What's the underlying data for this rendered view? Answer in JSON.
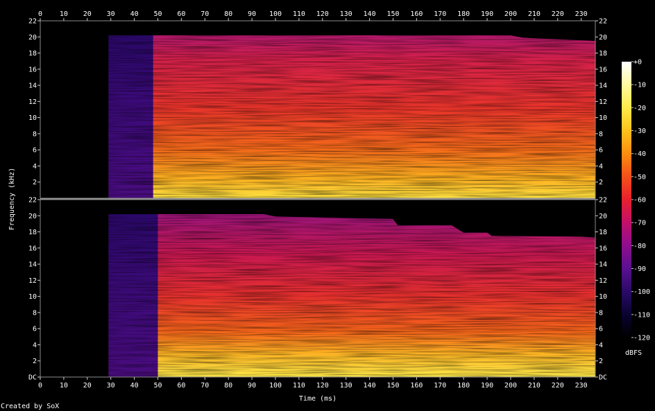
{
  "chart_data": {
    "type": "heatmap",
    "subtype": "spectrogram",
    "xlabel": "Time (ms)",
    "ylabel": "Frequency (kHz)",
    "xlim": [
      0,
      236
    ],
    "ylim": [
      0,
      22
    ],
    "x_ticks": [
      0,
      10,
      20,
      30,
      40,
      50,
      60,
      70,
      80,
      90,
      100,
      110,
      120,
      130,
      140,
      150,
      160,
      170,
      180,
      190,
      200,
      210,
      220,
      230
    ],
    "y_ticks": [
      0,
      2,
      4,
      6,
      8,
      10,
      12,
      14,
      16,
      18,
      20,
      22
    ],
    "y_tick_labels_top": [
      "2",
      "4",
      "6",
      "8",
      "10",
      "12",
      "14",
      "16",
      "18",
      "20",
      "22"
    ],
    "y_tick_labels_bottom": [
      "DC",
      "2",
      "4",
      "6",
      "8",
      "10",
      "12",
      "14",
      "16",
      "18",
      "20",
      "22"
    ],
    "channels": [
      {
        "onset_ms": 29,
        "loud_onset_ms": 48,
        "upper_edge_khz": [
          [
            29,
            20.2
          ],
          [
            200,
            20.2
          ],
          [
            205,
            19.9
          ],
          [
            236,
            19.5
          ]
        ]
      },
      {
        "onset_ms": 29,
        "loud_onset_ms": 50,
        "upper_edge_khz": [
          [
            29,
            20.2
          ],
          [
            95,
            20.2
          ],
          [
            100,
            19.9
          ],
          [
            150,
            19.6
          ],
          [
            152,
            18.8
          ],
          [
            175,
            18.8
          ],
          [
            180,
            17.9
          ],
          [
            190,
            17.9
          ],
          [
            192,
            17.5
          ],
          [
            230,
            17.4
          ],
          [
            236,
            17.3
          ]
        ]
      }
    ],
    "colorbar": {
      "label": "dBFS",
      "range": [
        -120,
        0
      ],
      "ticks": [
        0,
        -10,
        -20,
        -30,
        -40,
        -50,
        -60,
        -70,
        -80,
        -90,
        -100,
        -110,
        -120
      ],
      "tick_labels": [
        "+0",
        "-10",
        "-20",
        "-30",
        "-40",
        "-50",
        "-60",
        "-70",
        "-80",
        "-90",
        "-100",
        "-110",
        "-120"
      ],
      "stops": [
        "#000000",
        "#0a0330",
        "#2a0a68",
        "#5a1090",
        "#8e0e8e",
        "#c2106a",
        "#e8202e",
        "#f4501a",
        "#fb8d10",
        "#fdc21c",
        "#fdeb4a",
        "#fffba0",
        "#ffffff"
      ]
    }
  },
  "footer": {
    "credit": "Created by SoX"
  }
}
